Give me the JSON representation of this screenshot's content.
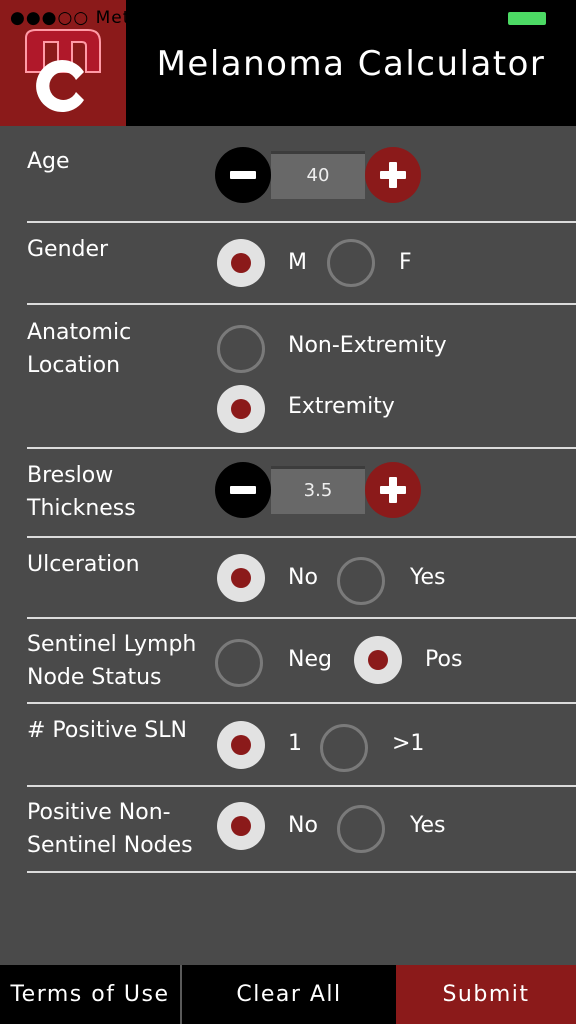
{
  "status_bar": {
    "carrier": "●●●○○ Metr"
  },
  "header": {
    "title": "Melanoma Calculator",
    "logo_text": "mc"
  },
  "fields": {
    "age": {
      "label": "Age",
      "value": "40"
    },
    "gender": {
      "label": "Gender",
      "options": [
        "M",
        "F"
      ],
      "selected": "M"
    },
    "anatomic_location": {
      "label_line1": "Anatomic",
      "label_line2": "Location",
      "options": [
        "Non-Extremity",
        "Extremity"
      ],
      "selected": "Extremity"
    },
    "breslow": {
      "label_line1": "Breslow",
      "label_line2": "Thickness",
      "value": "3.5"
    },
    "ulceration": {
      "label": "Ulceration",
      "options": [
        "No",
        "Yes"
      ],
      "selected": "No"
    },
    "sln_status": {
      "label_line1": "Sentinel Lymph",
      "label_line2": "Node Status",
      "options": [
        "Neg",
        "Pos"
      ],
      "selected": "Pos"
    },
    "positive_sln": {
      "label": "# Positive SLN",
      "options": [
        "1",
        ">1"
      ],
      "selected": "1"
    },
    "non_sentinel": {
      "label_line1": "Positive Non-",
      "label_line2": "Sentinel Nodes",
      "options": [
        "No",
        "Yes"
      ],
      "selected": "No"
    }
  },
  "footer": {
    "terms": "Terms of Use",
    "clear": "Clear All",
    "submit": "Submit"
  },
  "colors": {
    "accent": "#8b1a1a",
    "background": "#4a4a4a",
    "header": "#000000",
    "battery": "#4cd964"
  },
  "icons": {
    "minus": "minus-icon",
    "plus": "plus-icon"
  }
}
